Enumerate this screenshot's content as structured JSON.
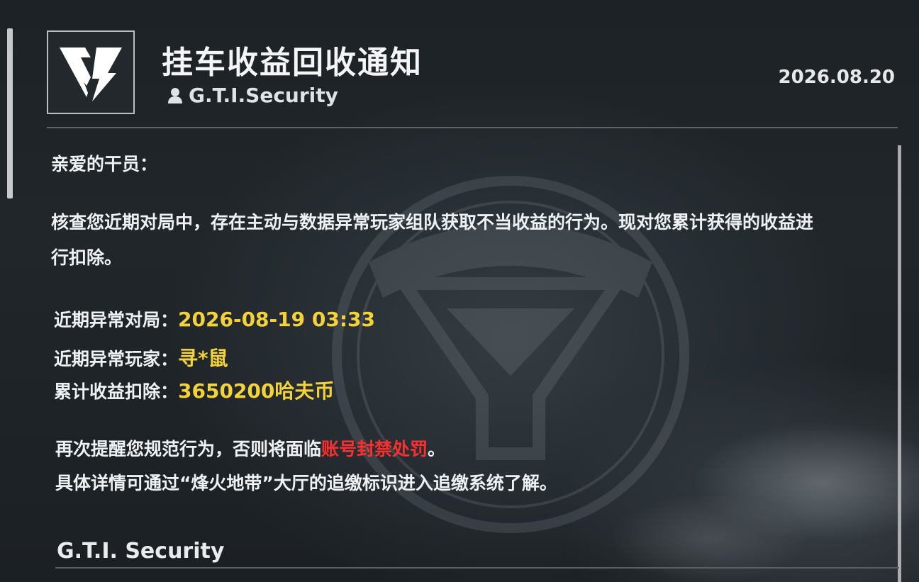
{
  "header": {
    "title": "挂车收益回收通知",
    "sender": "G.T.I.Security",
    "date": "2026.08.20"
  },
  "message": {
    "greeting": "亲爱的干员：",
    "paragraph_line1": "核查您近期对局中，存在主动与数据异常玩家组队获取不当收益的行为。现对您累计获得的收益进",
    "paragraph_line2": "行扣除。",
    "details": [
      {
        "label": "近期异常对局：",
        "value": "2026-08-19 03:33"
      },
      {
        "label": "近期异常玩家：",
        "value": "寻*鼠"
      },
      {
        "label": "累计收益扣除：",
        "value": "3650200哈夫币"
      }
    ],
    "warning_prefix": "再次提醒您规范行为，否则将面临",
    "warning_highlight": "账号封禁处罚",
    "warning_suffix": "。",
    "info_line": "具体详情可通过“烽火地带”大厅的追缴标识进入追缴系统了解。"
  },
  "footer": {
    "signature": "G.T.I. Security"
  },
  "colors": {
    "value_highlight": "#f4d33a",
    "danger": "#ff2f2f",
    "text": "#eef1f3",
    "background": "#1d2226"
  },
  "icons": {
    "logo": "gti-logo-icon",
    "sender": "user-icon"
  }
}
